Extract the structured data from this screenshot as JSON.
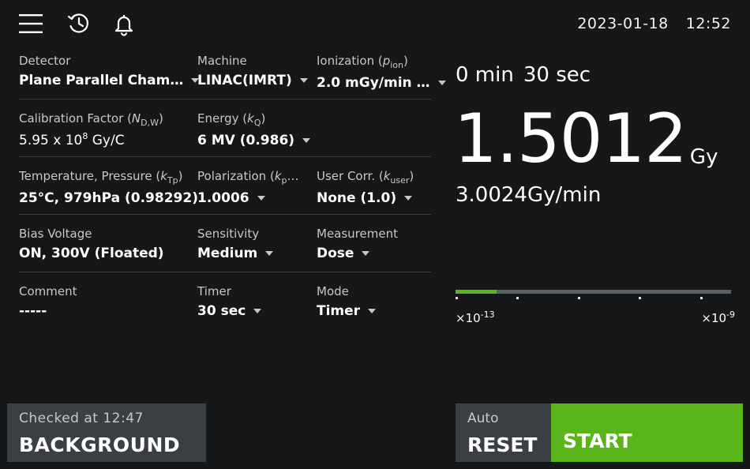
{
  "header": {
    "icons": [
      "menu-icon",
      "history-icon",
      "bell-icon"
    ],
    "date": "2023-01-18",
    "time": "12:52"
  },
  "settings": {
    "detector": {
      "label": "Detector",
      "value": "Plane Parallel Cham…"
    },
    "machine": {
      "label": "Machine",
      "value": "LINAC(IMRT)"
    },
    "ionization": {
      "label_main": "Ionization (",
      "label_sym": "p",
      "label_sub": "ion",
      "label_end": ")",
      "value": "2.0 mGy/min …"
    },
    "calibration": {
      "label_main": "Calibration Factor (",
      "label_sym": "N",
      "label_sub": "D,W",
      "label_end": ")",
      "value_main": "5.95 x 10",
      "value_exp": "8",
      "value_unit": " Gy/C"
    },
    "energy": {
      "label_main": "Energy (",
      "label_sym": "k",
      "label_sub": "Q",
      "label_end": ")",
      "value": "6 MV (0.986)"
    },
    "temperature": {
      "label_main": "Temperature, Pressure (",
      "label_sym": "k",
      "label_sub": "Tp",
      "label_end": ")",
      "value": "25°C, 979hPa (0.98292)"
    },
    "polarization": {
      "label_main": "Polarization (",
      "label_sym": "k",
      "label_sub": "p",
      "label_end": "…",
      "value": "1.0006"
    },
    "user_corr": {
      "label_main": "User Corr. (",
      "label_sym": "k",
      "label_sub": "user",
      "label_end": ")",
      "value": "None (1.0)"
    },
    "bias": {
      "label": "Bias Voltage",
      "value": "ON, 300V (Floated)"
    },
    "sensitivity": {
      "label": "Sensitivity",
      "value": "Medium"
    },
    "measurement": {
      "label": "Measurement",
      "value": "Dose"
    },
    "comment": {
      "label": "Comment",
      "value": "-----"
    },
    "timer": {
      "label": "Timer",
      "value": "30 sec"
    },
    "mode": {
      "label": "Mode",
      "value": "Timer"
    }
  },
  "readout": {
    "timer_min": "0 min",
    "timer_sec": "30 sec",
    "dose": "1.5012",
    "dose_unit": "Gy",
    "rate": "3.0024Gy/min",
    "range_bar_fraction": 0.15,
    "scale_min_base": "×10",
    "scale_min_exp": "-13",
    "scale_max_base": "×10",
    "scale_max_exp": "-9"
  },
  "buttons": {
    "background_sub": "Checked at 12:47",
    "background_label": "BACKGROUND",
    "reset_sub": "Auto",
    "reset_label": "RESET",
    "start_label": "START"
  },
  "colors": {
    "accent": "#5ab51b",
    "background": "#161719",
    "button": "#3b3f44"
  }
}
